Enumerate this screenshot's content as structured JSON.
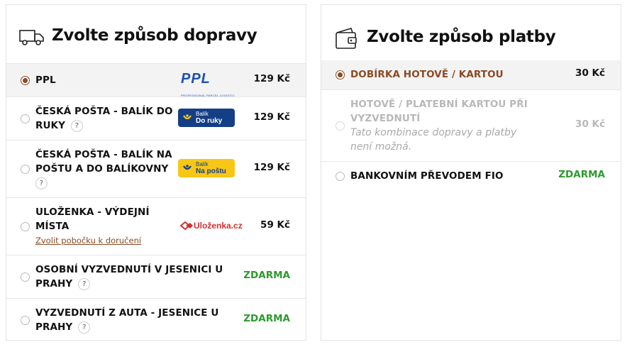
{
  "shipping": {
    "title": "Zvolte způsob dopravy",
    "icon": "truck-icon",
    "options": [
      {
        "label": "PPL",
        "price": "129 Kč",
        "logo": "PPL",
        "logo_sub": "PROFESSIONAL PARCEL LOGISTIC",
        "selected": true
      },
      {
        "label_l1": "ČESKÁ POŠTA - BALÍK DO",
        "label_l2": "RUKY",
        "price": "129 Kč",
        "logo_small": "Balík",
        "logo_big": "Do ruky"
      },
      {
        "label_l1": "ČESKÁ POŠTA - BALÍK NA",
        "label_l2": "POŠTU A DO BALÍKOVNY",
        "price": "129 Kč",
        "logo_small": "Balík",
        "logo_big": "Na poštu"
      },
      {
        "label_l1": "ULOŽENKA - VÝDEJNÍ",
        "label_l2": "MÍSTA",
        "link": "Zvolit pobočku k doručení",
        "price": "59 Kč",
        "logo": "Uloženka.cz"
      },
      {
        "label_l1": "OSOBNÍ VYZVEDNUTÍ V JESENICI U",
        "label_l2": "PRAHY",
        "price": "ZDARMA"
      },
      {
        "label_l1": "VYZVEDNUTÍ Z AUTA - JESENICE U",
        "label_l2": "PRAHY",
        "price": "ZDARMA"
      }
    ],
    "help_glyph": "?"
  },
  "payment": {
    "title": "Zvolte způsob platby",
    "icon": "wallet-icon",
    "options": [
      {
        "label": "DOBÍRKA HOTOVĚ / KARTOU",
        "price": "30 Kč",
        "selected": true
      },
      {
        "label_l1": "HOTOVĚ / PLATEBNÍ KARTOU PŘI",
        "label_l2": "VYZVEDNUTÍ",
        "note_l1": "Tato kombinace dopravy a platby",
        "note_l2": "není možná.",
        "price": "30 Kč",
        "disabled": true
      },
      {
        "label": "BANKOVNÍM PŘEVODEM FIO",
        "price": "ZDARMA"
      }
    ]
  },
  "colors": {
    "accent": "#8a4a22",
    "free": "#2c9a2c",
    "muted": "#b8b8b8",
    "selected_bg": "#f3f3f3"
  }
}
